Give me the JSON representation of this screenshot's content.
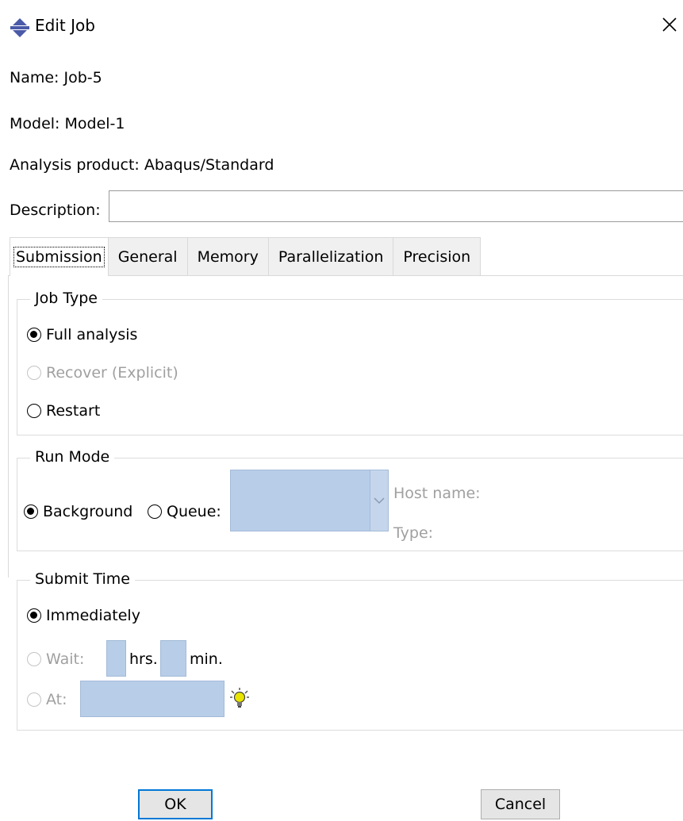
{
  "window": {
    "title": "Edit Job",
    "icon": "abaqus-job-icon",
    "close_icon": "close-icon"
  },
  "info": {
    "name_label": "Name:",
    "name_value": "Job-5",
    "model_label": "Model:",
    "model_value": "Model-1",
    "product_label": "Analysis product:",
    "product_value": "Abaqus/Standard"
  },
  "description": {
    "label": "Description:",
    "value": ""
  },
  "tabs": [
    "Submission",
    "General",
    "Memory",
    "Parallelization",
    "Precision"
  ],
  "job_type": {
    "legend": "Job Type",
    "options": [
      "Full analysis",
      "Recover (Explicit)",
      "Restart"
    ],
    "selected": "Full analysis"
  },
  "run_mode": {
    "legend": "Run Mode",
    "background_label": "Background",
    "queue_label": "Queue:",
    "selected": "Background",
    "host_name_label": "Host name:",
    "type_label": "Type:"
  },
  "submit_time": {
    "legend": "Submit Time",
    "immediately_label": "Immediately",
    "wait_label": "Wait:",
    "hrs_label": "hrs.",
    "min_label": "min.",
    "at_label": "At:",
    "selected": "Immediately",
    "hint_icon": "lightbulb-icon"
  },
  "buttons": {
    "ok": "OK",
    "cancel": "Cancel"
  },
  "colors": {
    "field_blue": "#b7cde8",
    "default_button_border": "#0078d7",
    "icon_blue": "#4a5aa8"
  }
}
